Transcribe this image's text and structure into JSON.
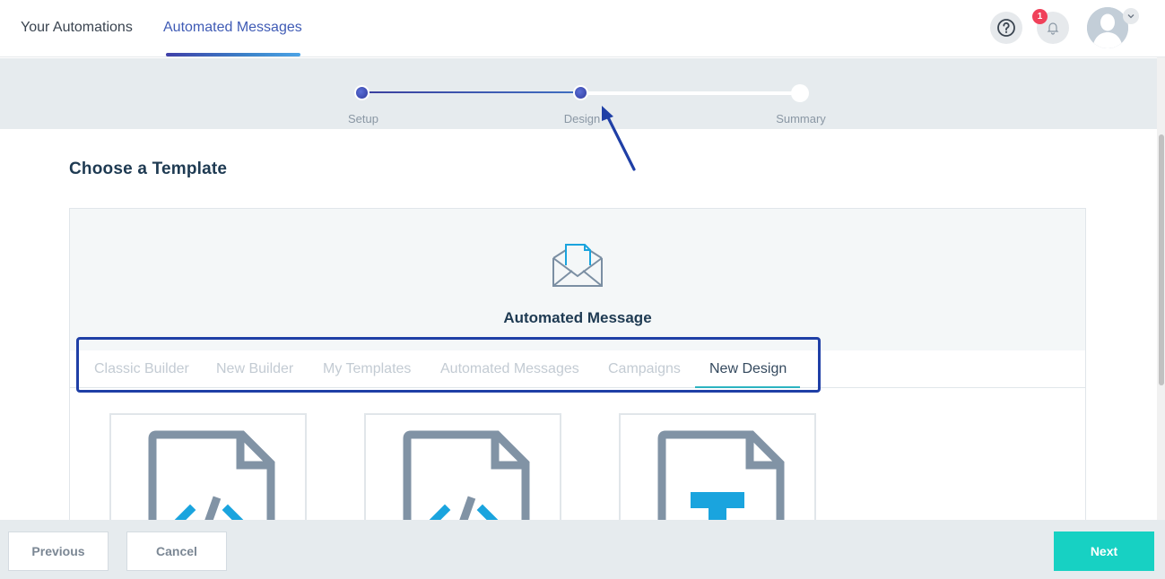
{
  "nav": {
    "tabs": [
      {
        "label": "Your Automations"
      },
      {
        "label": "Automated Messages"
      }
    ],
    "help_icon": "question-circle-icon",
    "bell_icon": "bell-icon",
    "notification_count": "1",
    "avatar_icon": "user-avatar"
  },
  "stepper": {
    "steps": [
      {
        "label": "Setup"
      },
      {
        "label": "Design"
      },
      {
        "label": "Summary"
      }
    ],
    "current_step": "Design"
  },
  "page": {
    "title": "Choose a Template"
  },
  "panel": {
    "title": "Automated Message",
    "icon": "envelope-open-icon",
    "tabs": [
      {
        "label": "Classic Builder"
      },
      {
        "label": "New Builder"
      },
      {
        "label": "My Templates"
      },
      {
        "label": "Automated Messages"
      },
      {
        "label": "Campaigns"
      },
      {
        "label": "New Design"
      }
    ],
    "active_tab": "New Design",
    "cards": [
      {
        "icon": "code-file-icon"
      },
      {
        "icon": "code-file-icon"
      },
      {
        "icon": "text-file-icon"
      }
    ]
  },
  "footer": {
    "previous_label": "Previous",
    "cancel_label": "Cancel",
    "next_label": "Next"
  },
  "colors": {
    "accent": "#3f5bb5",
    "primary_button": "#17d1c3",
    "annotation": "#1f3fa6",
    "badge": "#f0415a"
  }
}
